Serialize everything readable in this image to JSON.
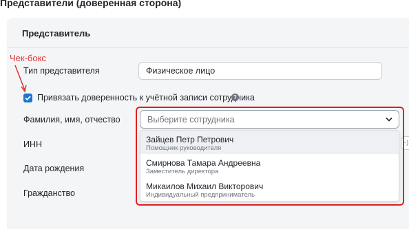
{
  "section": {
    "title": "Представители (доверенная сторона)"
  },
  "card": {
    "title": "Представитель"
  },
  "annotation": {
    "label": "Чек-бокс",
    "color": "#e03131"
  },
  "fields": {
    "type_label": "Тип представителя",
    "type_value": "Физическое лицо",
    "checkbox_label": "Привязать доверенность к учётной записи сотрудника",
    "checkbox_checked": true,
    "help_icon_glyph": "?",
    "fio_label": "Фамилия, имя, отчество",
    "employee_placeholder": "Выберите сотрудника",
    "inn_label": "ИНН",
    "birth_label": "Дата рождения",
    "citizenship_label": "Гражданство",
    "edge_text": "~)"
  },
  "dropdown": {
    "options": [
      {
        "name": "Зайцев Петр Петрович",
        "role": "Помощник руководителя"
      },
      {
        "name": "Смирнова Тамара Андреевна",
        "role": "Заместитель директора"
      },
      {
        "name": "Микаилов Михаил Викторович",
        "role": "Индивидуальный предприниматель"
      }
    ]
  },
  "colors": {
    "accent": "#1976d2",
    "highlight": "#e02020",
    "card_bg": "#f4f5f7"
  },
  "icons": {
    "help": "question-circle-icon",
    "chevron": "chevron-down-icon",
    "check": "check-icon",
    "arrow": "annotation-arrow-icon"
  }
}
